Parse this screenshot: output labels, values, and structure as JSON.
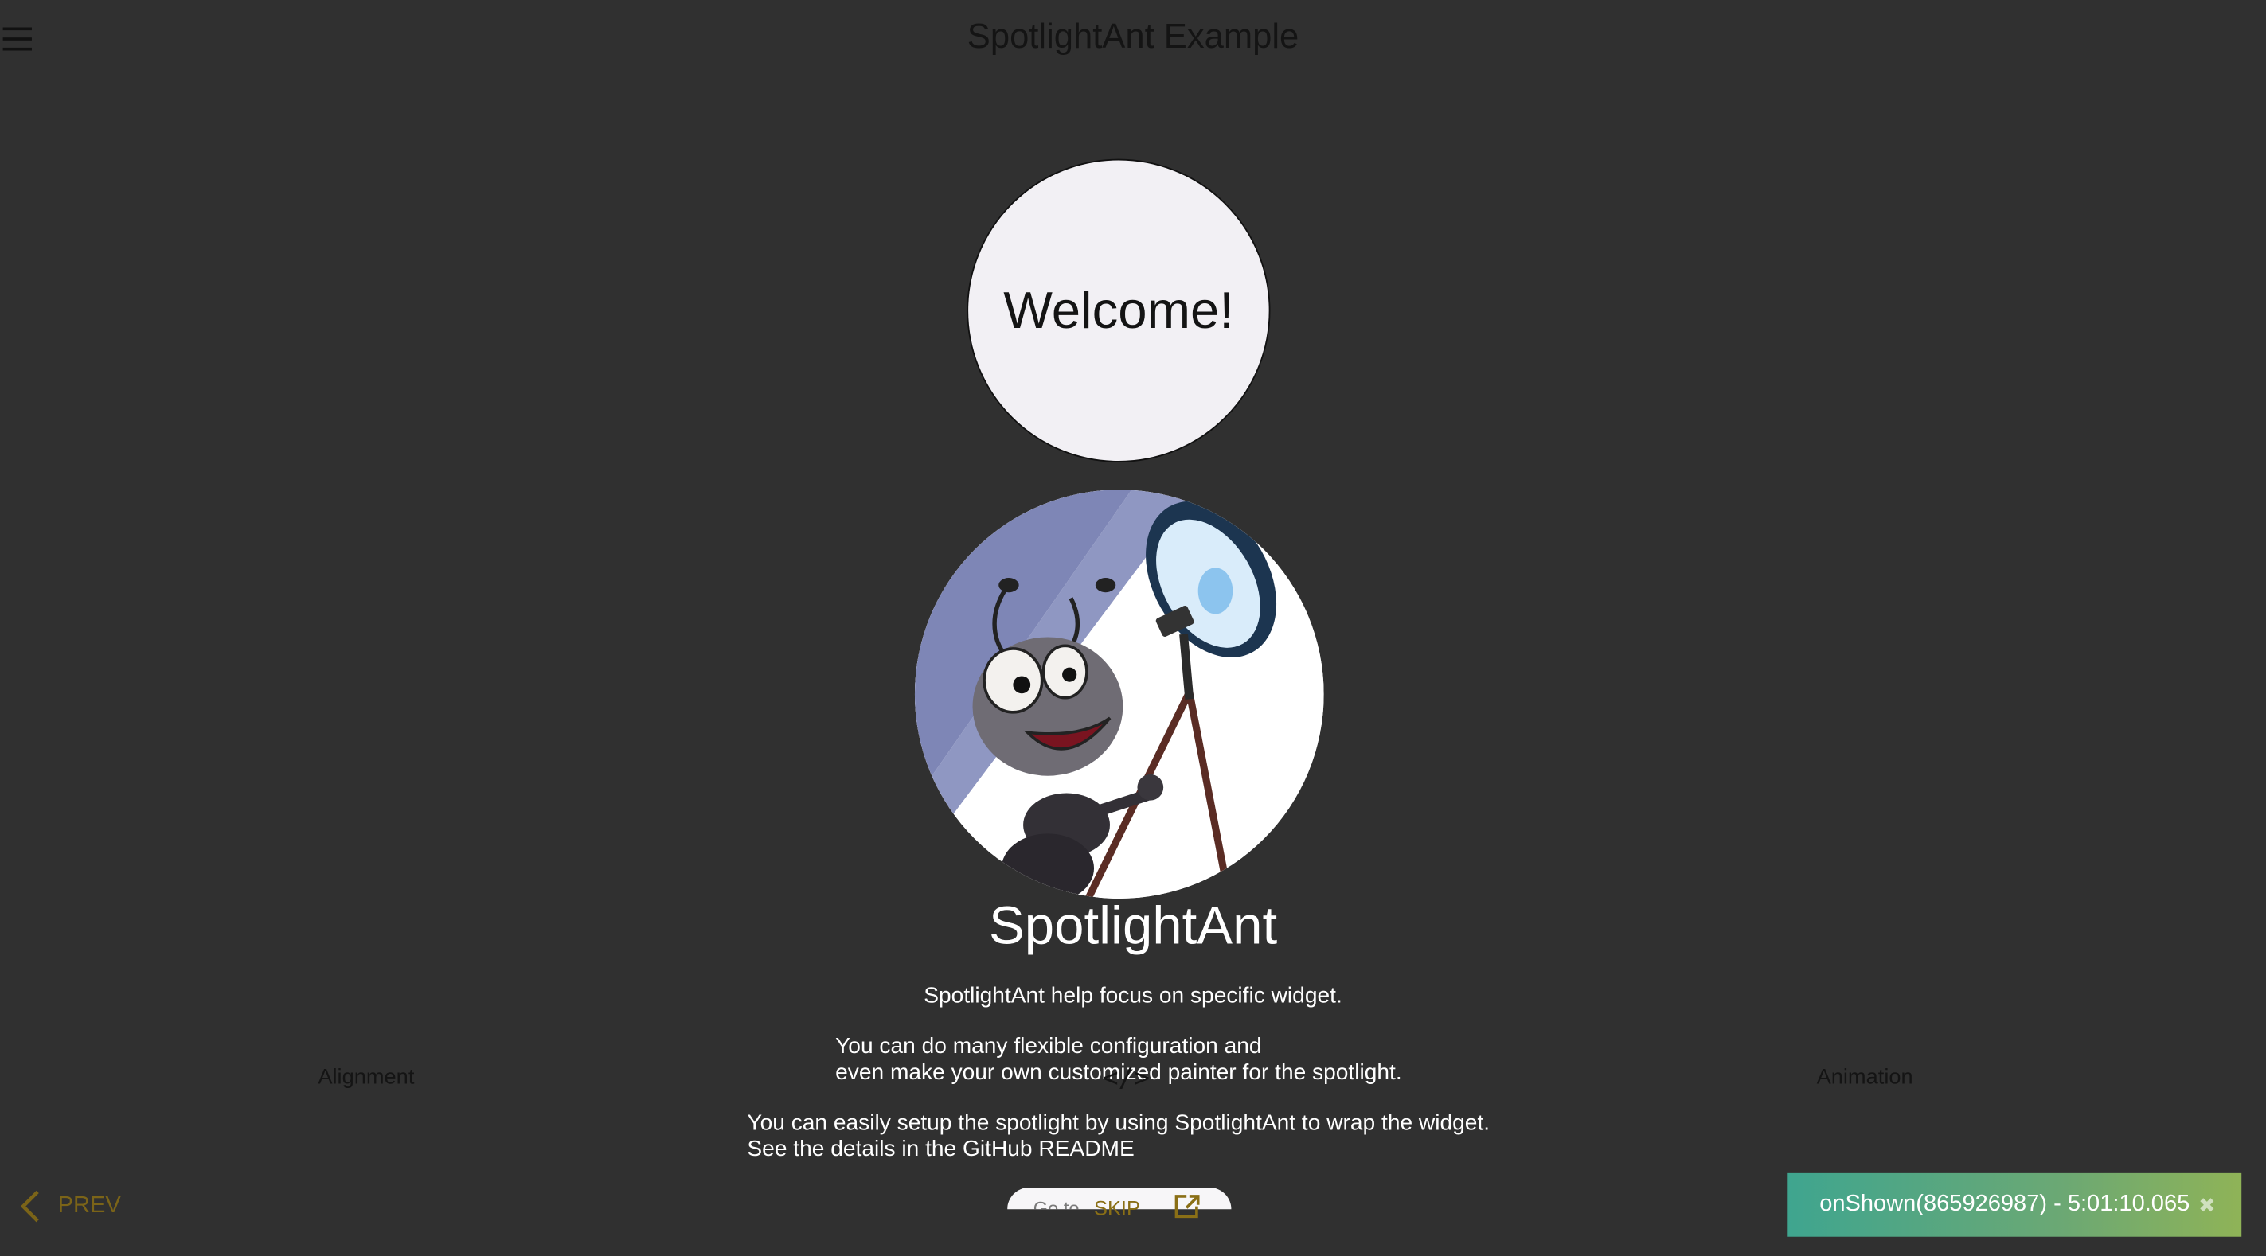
{
  "appbar": {
    "title": "SpotlightAnt Example",
    "menu_icon": "menu-icon"
  },
  "welcome": {
    "label": "Welcome!"
  },
  "intro": {
    "title": "SpotlightAnt",
    "line1": "SpotlightAnt help focus on specific widget.",
    "line2": "You can do many flexible configuration and",
    "line3": "even make your own customized painter for the spotlight.",
    "line4": "You can easily setup the spotlight by using SpotlightAnt to wrap the widget.",
    "line5": "See the details in the GitHub README"
  },
  "buttons": {
    "alignment": "Alignment",
    "animation": "Animation",
    "bottom_pill_partial": "Go to",
    "center_icon": "code-icon"
  },
  "controls": {
    "prev": "PREV",
    "skip": "SKIP",
    "external_icon": "open-in-new-icon"
  },
  "toast": {
    "message": "onShown(865926987) - 5:01:10.065",
    "close_icon": "close-icon"
  },
  "colors": {
    "overlay_background": "#303030",
    "accent_gold": "#7b6418",
    "toast_start": "#3fa58f",
    "toast_end": "#8fb357"
  }
}
